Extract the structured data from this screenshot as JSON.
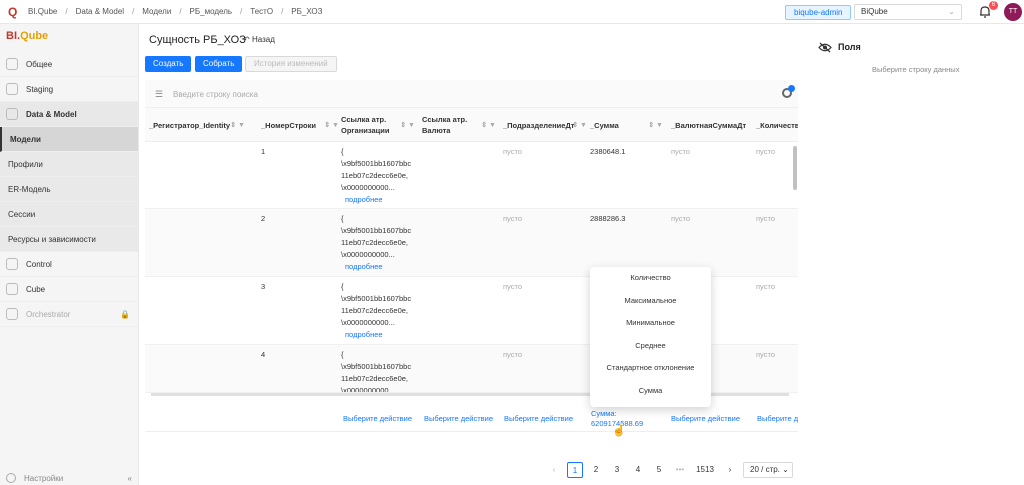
{
  "topbar": {
    "breadcrumbs": [
      "BI.Qube",
      "Data & Model",
      "Модели",
      "РБ_модель",
      "ТестО",
      "РБ_ХОЗ"
    ],
    "user_tag": "biqube-admin",
    "workspace": "BiQube",
    "notif_count": "6",
    "avatar": "TT"
  },
  "sidebar": {
    "brand_a": "BI.",
    "brand_b": "Qube",
    "items": [
      "Общее",
      "Staging",
      "Data & Model",
      "Модели",
      "Профили",
      "ER-Модель",
      "Сессии",
      "Ресурсы и зависимости",
      "Control",
      "Cube",
      "Orchestrator"
    ],
    "footer": "Настройки"
  },
  "main": {
    "title": "Сущность РБ_ХОЗ",
    "back": "Назад",
    "btn_create": "Создать",
    "btn_build": "Собрать",
    "btn_history": "История изменений",
    "search_placeholder": "Введите строку поиска"
  },
  "table": {
    "columns": [
      "_Регистратор_Identity",
      "_НомерСтроки",
      "Ссылка атр. Организации",
      "Ссылка атр. Валюта",
      "_ПодразделениеДт",
      "_Сумма",
      "_ВалютнаяСуммаДт",
      "_Количество"
    ],
    "rows": [
      {
        "num": "1",
        "org": [
          "{",
          "\\x9bf5001bb1607bbc",
          "11eb07c2decc6e0e,",
          "\\x0000000000..."
        ],
        "more": "подробнее",
        "pod": "пусто",
        "sum": "2380648.1",
        "val": "пусто",
        "kol": "пусто"
      },
      {
        "num": "2",
        "org": [
          "{",
          "\\x9bf5001bb1607bbc",
          "11eb07c2decc6e0e,",
          "\\x0000000000..."
        ],
        "more": "подробнее",
        "pod": "пусто",
        "sum": "2888286.3",
        "val": "пусто",
        "kol": "пусто"
      },
      {
        "num": "3",
        "org": [
          "{",
          "\\x9bf5001bb1607bbc",
          "11eb07c2decc6e0e,",
          "\\x0000000000..."
        ],
        "more": "подробнее",
        "pod": "пусто",
        "sum": "",
        "val": "пусто",
        "kol": "пусто"
      },
      {
        "num": "4",
        "org": [
          "{",
          "\\x9bf5001bb1607bbc",
          "11eb07c2decc6e0e,",
          "\\x0000000000..."
        ],
        "more": "",
        "pod": "пусто",
        "sum": "",
        "val": "пусто",
        "kol": "пусто"
      }
    ],
    "action": "Выберите действие",
    "sum_label": "Сумма:",
    "sum_value": "6209174588.69"
  },
  "popup": [
    "Количество",
    "Максимальное",
    "Минимальное",
    "Среднее",
    "Стандартное отклонение",
    "Сумма"
  ],
  "pager": {
    "pages": [
      "1",
      "2",
      "3",
      "4",
      "5"
    ],
    "ellipsis": "•••",
    "last": "1513",
    "size": "20 / стр."
  },
  "right": {
    "title": "Поля",
    "subtitle": "Выберите строку данных"
  }
}
